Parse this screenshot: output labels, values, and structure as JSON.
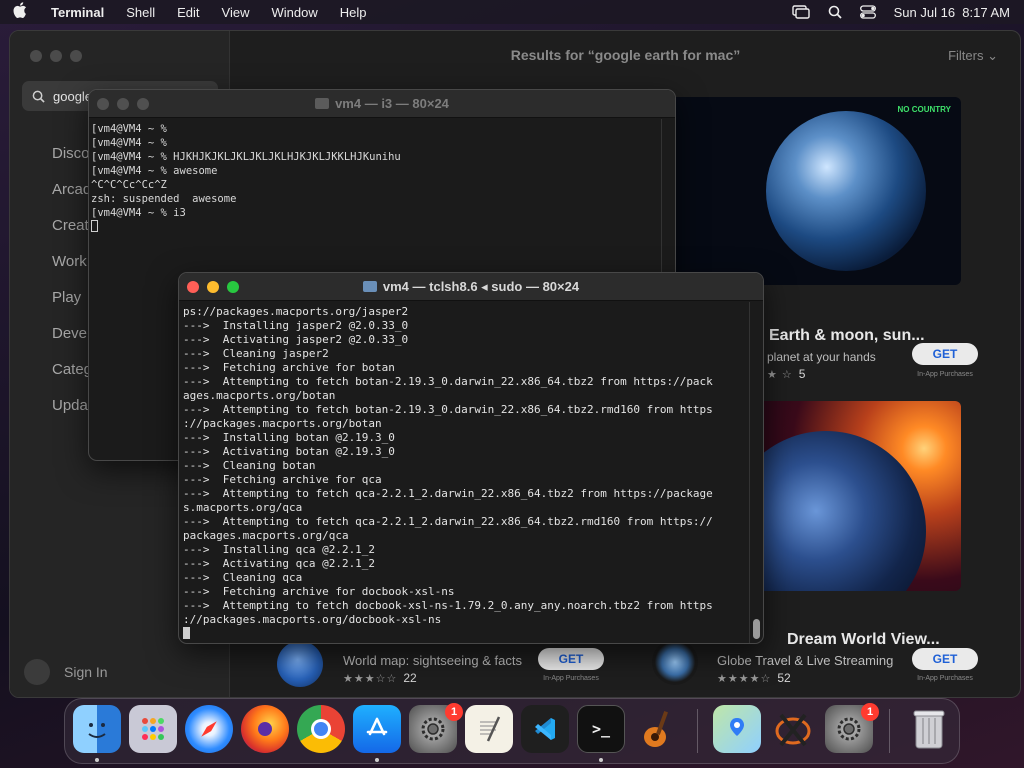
{
  "menubar": {
    "app_name": "Terminal",
    "items": [
      "Shell",
      "Edit",
      "View",
      "Window",
      "Help"
    ],
    "clock": "Sun Jul 16  8:17 AM"
  },
  "appstore": {
    "search_value": "google",
    "results_title": "Results for “google earth for mac”",
    "filters_label": "Filters",
    "sidebar": [
      "Discover",
      "Arcade",
      "Create",
      "Work",
      "Play",
      "Develop",
      "Categories",
      "Updates"
    ],
    "sign_in": "Sign In",
    "card_badge": "NO COUNTRY",
    "apps": [
      {
        "title": "Earth & moon, sun...",
        "subtitle": "planet at your hands",
        "rating": "5",
        "get": "GET",
        "iap": "In-App Purchases"
      },
      {
        "title": "World map: sightseeing & facts",
        "subtitle": "",
        "rating": "22",
        "get": "GET",
        "iap": "In-App Purchases"
      },
      {
        "title": "Dream World View...",
        "subtitle": "Globe Travel & Live Streaming",
        "rating": "52",
        "get": "GET",
        "iap": "In-App Purchases"
      }
    ]
  },
  "term_back": {
    "title": "vm4 — i3 — 80×24",
    "lines": [
      "[vm4@VM4 ~ % ",
      "[vm4@VM4 ~ % ",
      "[vm4@VM4 ~ % HJKHJKJKLJKLJKLJKLHJKJKLJKKLHJKunihu",
      "[vm4@VM4 ~ % awesome",
      "^C^C^Cc^Cc^Z",
      "zsh: suspended  awesome",
      "[vm4@VM4 ~ % i3"
    ]
  },
  "term_front": {
    "title": "vm4 — tclsh8.6 ◂ sudo — 80×24",
    "lines": [
      "ps://packages.macports.org/jasper2",
      "--->  Installing jasper2 @2.0.33_0",
      "--->  Activating jasper2 @2.0.33_0",
      "--->  Cleaning jasper2",
      "--->  Fetching archive for botan",
      "--->  Attempting to fetch botan-2.19.3_0.darwin_22.x86_64.tbz2 from https://pack",
      "ages.macports.org/botan",
      "--->  Attempting to fetch botan-2.19.3_0.darwin_22.x86_64.tbz2.rmd160 from https",
      "://packages.macports.org/botan",
      "--->  Installing botan @2.19.3_0",
      "--->  Activating botan @2.19.3_0",
      "--->  Cleaning botan",
      "--->  Fetching archive for qca",
      "--->  Attempting to fetch qca-2.2.1_2.darwin_22.x86_64.tbz2 from https://package",
      "s.macports.org/qca",
      "--->  Attempting to fetch qca-2.2.1_2.darwin_22.x86_64.tbz2.rmd160 from https://",
      "packages.macports.org/qca",
      "--->  Installing qca @2.2.1_2",
      "--->  Activating qca @2.2.1_2",
      "--->  Cleaning qca",
      "--->  Fetching archive for docbook-xsl-ns",
      "--->  Attempting to fetch docbook-xsl-ns-1.79.2_0.any_any.noarch.tbz2 from https",
      "://packages.macports.org/docbook-xsl-ns"
    ]
  },
  "dock": {
    "badges": {
      "settings": "1",
      "settings2": "1"
    },
    "terminal_glyph": ">_"
  }
}
